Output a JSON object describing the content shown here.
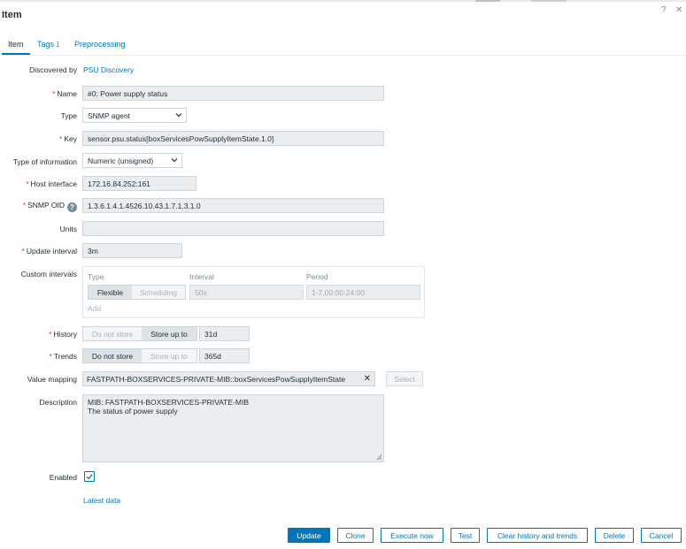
{
  "dialog": {
    "title": "Item",
    "help_glyph": "?",
    "close_glyph": "✕"
  },
  "tabs": [
    {
      "label": "Item"
    },
    {
      "label": "Tags",
      "count": "1"
    },
    {
      "label": "Preprocessing"
    }
  ],
  "form": {
    "discovered_by": {
      "label": "Discovered by",
      "value": "PSU Discovery"
    },
    "name": {
      "label": "Name",
      "value": "#0: Power supply status"
    },
    "type": {
      "label": "Type",
      "value": "SNMP agent"
    },
    "key": {
      "label": "Key",
      "value": "sensor.psu.status[boxServicesPowSupplyItemState.1.0]"
    },
    "type_of_information": {
      "label": "Type of information",
      "value": "Numeric (unsigned)"
    },
    "host_interface": {
      "label": "Host interface",
      "value": "172.16.84.252:161"
    },
    "snmp_oid": {
      "label": "SNMP OID",
      "value": "1.3.6.1.4.1.4526.10.43.1.7.1.3.1.0",
      "help_glyph": "?"
    },
    "units": {
      "label": "Units",
      "value": ""
    },
    "update_interval": {
      "label": "Update interval",
      "value": "3m"
    },
    "custom_intervals": {
      "label": "Custom intervals",
      "headers": [
        "Type",
        "Interval",
        "Period"
      ],
      "type_options": [
        {
          "label": "Flexible",
          "selected": true
        },
        {
          "label": "Scheduling",
          "selected": false
        }
      ],
      "interval_placeholder": "50s",
      "period_placeholder": "1-7,00:00-24:00",
      "add_label": "Add"
    },
    "history": {
      "label": "History",
      "options": [
        {
          "label": "Do not store",
          "selected": false
        },
        {
          "label": "Store up to",
          "selected": true
        }
      ],
      "value": "31d"
    },
    "trends": {
      "label": "Trends",
      "options": [
        {
          "label": "Do not store",
          "selected": true
        },
        {
          "label": "Store up to",
          "selected": false
        }
      ],
      "value": "365d"
    },
    "value_mapping": {
      "label": "Value mapping",
      "value": "FASTPATH-BOXSERVICES-PRIVATE-MIB::boxServicesPowSupplyItemState",
      "remove_glyph": "✕",
      "select_label": "Select"
    },
    "description": {
      "label": "Description",
      "lines": [
        "MIB: FASTPATH-BOXSERVICES-PRIVATE-MIB",
        "The status of power supply"
      ]
    },
    "enabled": {
      "label": "Enabled",
      "checked": true
    },
    "latest_data_link": "Latest data"
  },
  "footer": {
    "buttons": [
      "Update",
      "Clone",
      "Execute now",
      "Test",
      "Clear history and trends",
      "Delete",
      "Cancel"
    ]
  },
  "colors": {
    "accent": "#0275b8",
    "required": "#e33734",
    "field_bg": "#ebeef0"
  }
}
